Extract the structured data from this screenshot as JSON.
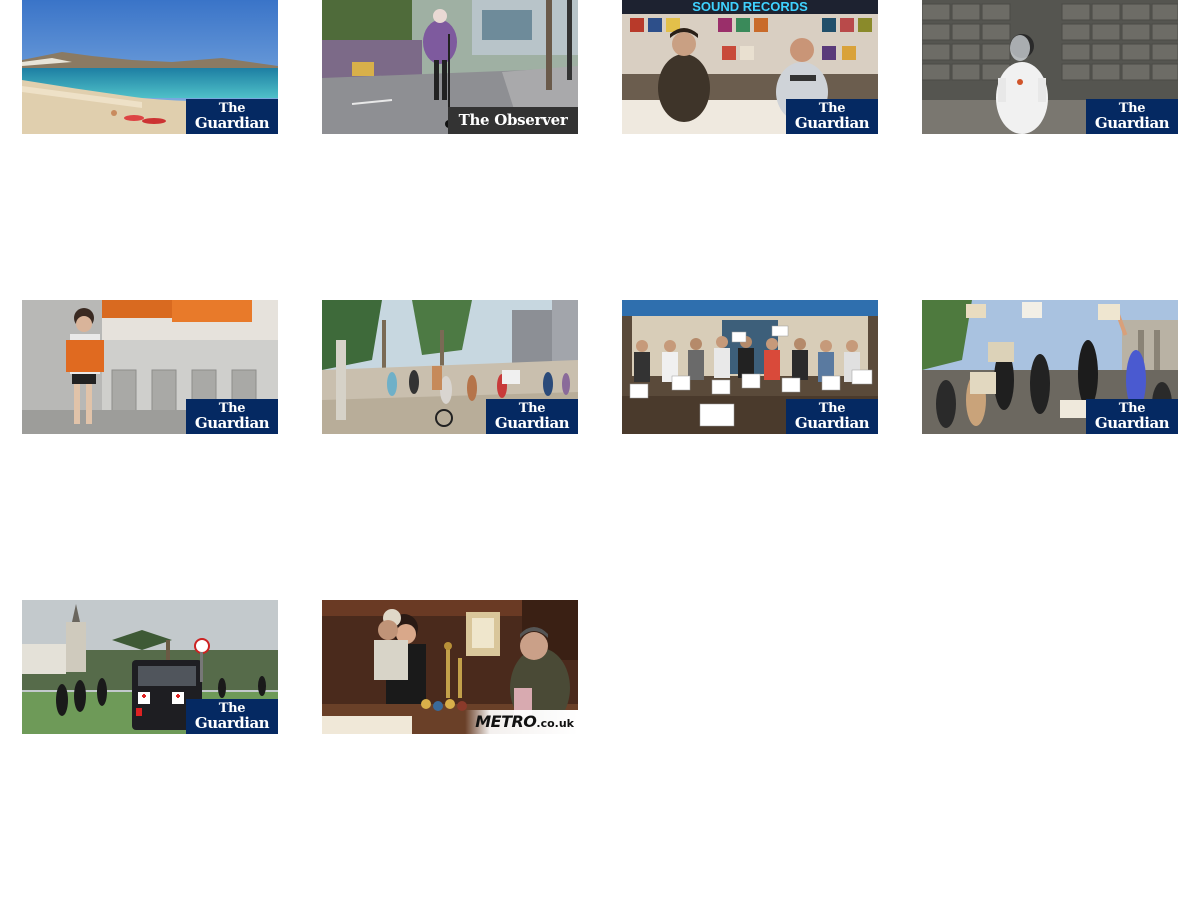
{
  "thumbnails": [
    {
      "source": "guardian",
      "badge_line1": "The",
      "badge_line2": "Guardian",
      "scene": "beach-with-sunbathers"
    },
    {
      "source": "observer",
      "badge_text": "The Observer",
      "scene": "woman-on-scooter-street"
    },
    {
      "source": "guardian",
      "badge_line1": "The",
      "badge_line2": "Guardian",
      "scene": "record-shop-two-men",
      "sign_text": "SOUND RECORDS"
    },
    {
      "source": "guardian",
      "badge_line1": "The",
      "badge_line2": "Guardian",
      "scene": "person-in-protective-suit"
    },
    {
      "source": "guardian",
      "badge_line1": "The",
      "badge_line2": "Guardian",
      "scene": "woman-at-ticket-gates"
    },
    {
      "source": "guardian",
      "badge_line1": "The",
      "badge_line2": "Guardian",
      "scene": "crowded-beach-boardwalk"
    },
    {
      "source": "guardian",
      "badge_line1": "The",
      "badge_line2": "Guardian",
      "scene": "group-holding-signs"
    },
    {
      "source": "guardian",
      "badge_line1": "The",
      "badge_line2": "Guardian",
      "scene": "black-lives-matter-protest"
    },
    {
      "source": "guardian",
      "badge_line1": "The",
      "badge_line2": "Guardian",
      "scene": "park-with-police-and-van"
    },
    {
      "source": "metro",
      "badge_main": "METRO",
      "badge_suffix": ".co.uk",
      "scene": "pub-bar-scene"
    }
  ],
  "colors": {
    "guardian_blue": "#052962",
    "observer_gray": "#333333",
    "page_background": "#ffffff"
  }
}
